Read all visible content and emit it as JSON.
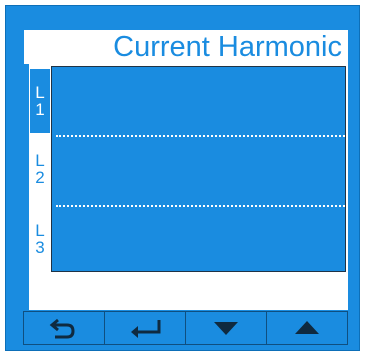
{
  "screen": {
    "title": "Current Harmonic"
  },
  "phases": [
    {
      "letter": "L",
      "number": "1",
      "active": true
    },
    {
      "letter": "L",
      "number": "2",
      "active": false
    },
    {
      "letter": "L",
      "number": "3",
      "active": false
    }
  ],
  "buttons": [
    {
      "icon": "back-arrow-icon"
    },
    {
      "icon": "enter-arrow-icon"
    },
    {
      "icon": "down-triangle-icon"
    },
    {
      "icon": "up-triangle-icon"
    }
  ],
  "colors": {
    "panel_blue": "#1a8ce0",
    "white": "#ffffff",
    "dark_navy": "#0f2a40"
  }
}
